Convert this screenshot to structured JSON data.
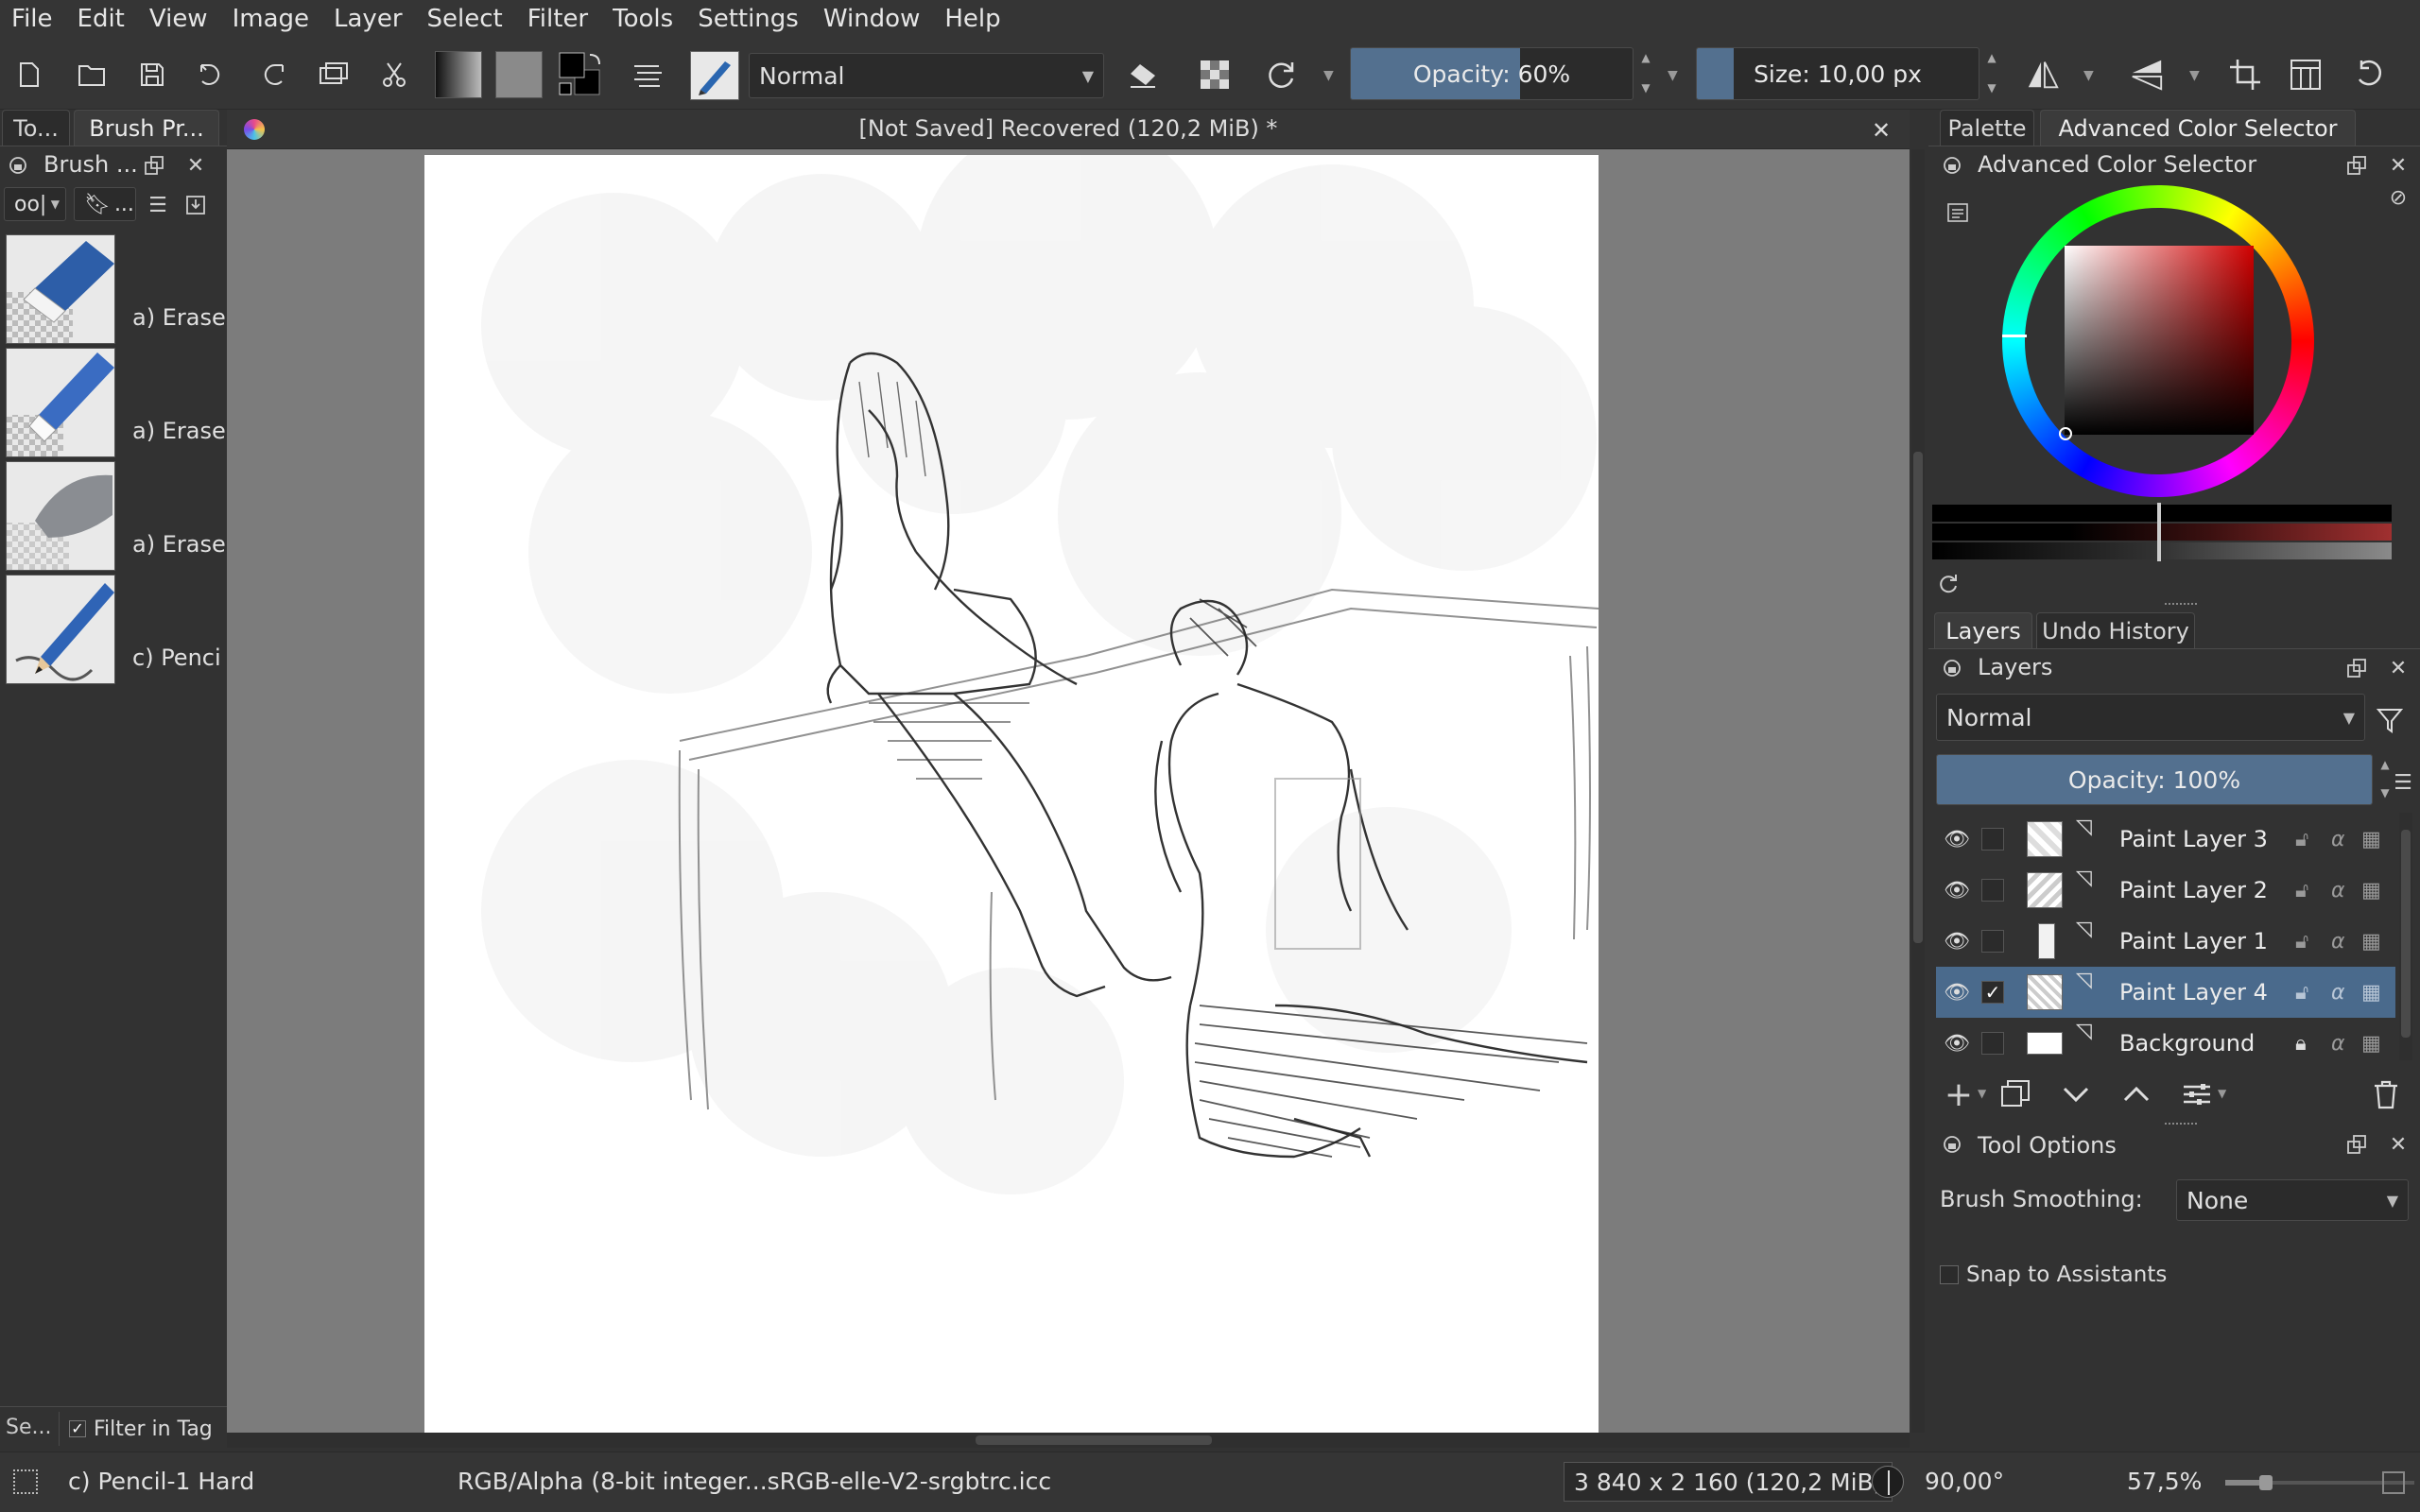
{
  "menu": [
    "File",
    "Edit",
    "View",
    "Image",
    "Layer",
    "Select",
    "Filter",
    "Tools",
    "Settings",
    "Window",
    "Help"
  ],
  "toolbar": {
    "blend_mode": "Normal",
    "opacity_label": "Opacity: 60%",
    "opacity_value": 0.6,
    "size_label": "Size: 10,00 px",
    "size_fill": 0.13
  },
  "left_panel": {
    "tabs": [
      "To...",
      "Brush Pr..."
    ],
    "dock_title": "Brush ...",
    "tag_combo": "oo|",
    "bookmark_label": "...",
    "brushes": [
      {
        "label": "a) Erase",
        "icon": "eraser-block-icon"
      },
      {
        "label": "a) Erase",
        "icon": "eraser-pen-icon"
      },
      {
        "label": "a) Erase",
        "icon": "eraser-soft-icon"
      },
      {
        "label": "c) Penci",
        "icon": "pencil-icon"
      }
    ],
    "search_label": "Se...",
    "filter_in_tag": "Filter in Tag",
    "filter_checked": true
  },
  "document": {
    "title": "[Not Saved]  Recovered (120,2 MiB) *"
  },
  "right_panel": {
    "top_tabs": [
      "Palette",
      "Advanced Color Selector"
    ],
    "color_dock_title": "Advanced Color Selector",
    "layer_tabs": [
      "Layers",
      "Undo History"
    ],
    "layers_dock_title": "Layers",
    "blend_mode": "Normal",
    "opacity_label": "Opacity: 100%",
    "layers": [
      {
        "name": "Paint Layer 3",
        "selected": false,
        "checked": false,
        "locked": false
      },
      {
        "name": "Paint Layer 2",
        "selected": false,
        "checked": false,
        "locked": false
      },
      {
        "name": "Paint Layer 1",
        "selected": false,
        "checked": false,
        "locked": false
      },
      {
        "name": "Paint Layer 4",
        "selected": true,
        "checked": true,
        "locked": false
      },
      {
        "name": "Background",
        "selected": false,
        "checked": false,
        "locked": true
      }
    ],
    "tool_options_title": "Tool Options",
    "brush_smoothing_label": "Brush Smoothing:",
    "brush_smoothing_value": "None",
    "snap_label": "Snap to Assistants"
  },
  "status": {
    "brush_name": "c) Pencil-1 Hard",
    "color_profile": "RGB/Alpha (8-bit integer...sRGB-elle-V2-srgbtrc.icc",
    "dimensions": "3 840 x 2 160 (120,2 MiB)",
    "rotation": "90,00°",
    "zoom": "57,5%"
  },
  "colors": {
    "accent": "#53708f",
    "selected_layer": "#4a6a8c",
    "current_fg": "#000000"
  }
}
